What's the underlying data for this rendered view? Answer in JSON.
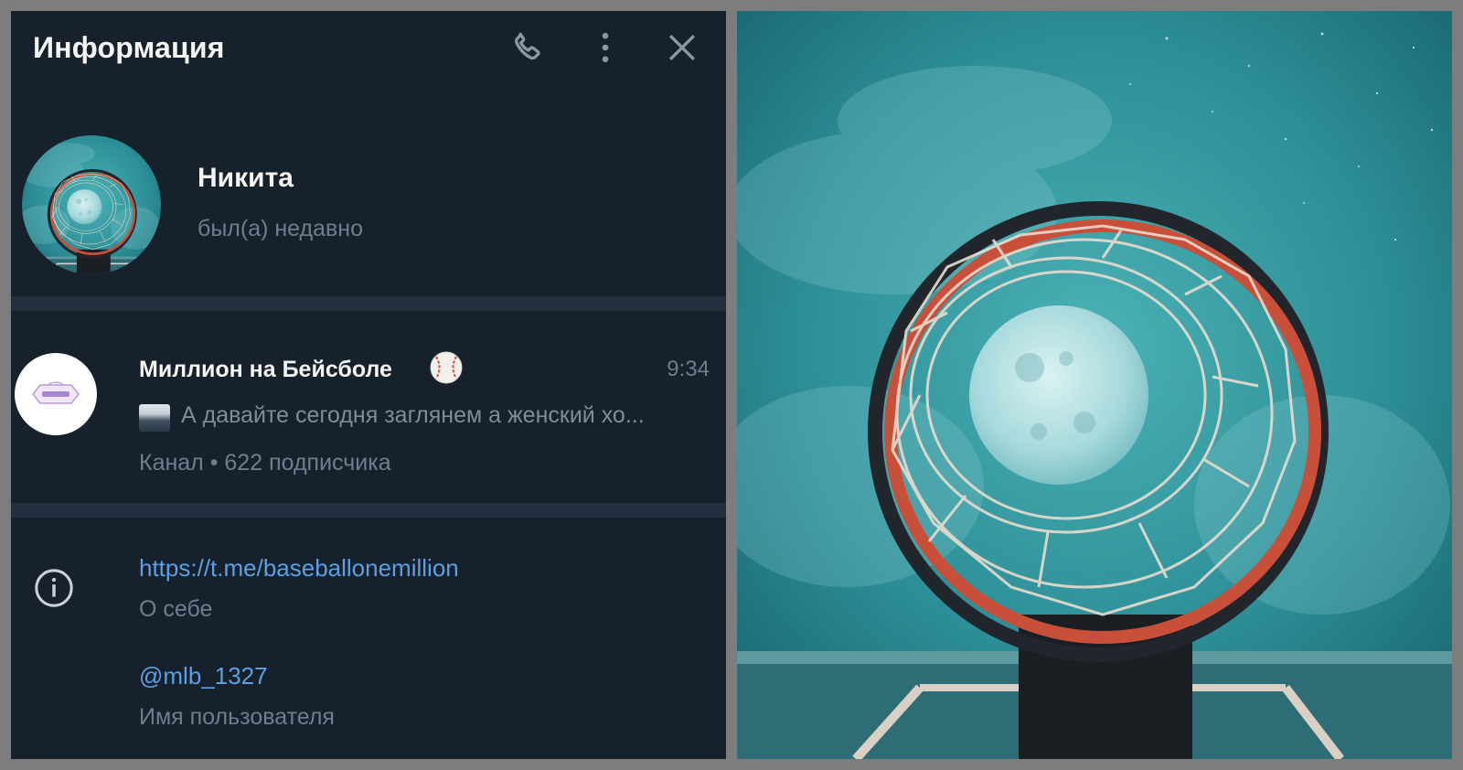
{
  "header": {
    "title": "Информация",
    "icons": [
      "phone-icon",
      "more-vertical-icon",
      "close-icon"
    ]
  },
  "profile": {
    "name": "Никита",
    "status": "был(а) недавно",
    "avatar": "basketball-hoop-photo"
  },
  "channel": {
    "name": "Миллион на Бейсболе",
    "emoji": "baseball-emoji",
    "time": "9:34",
    "last_message": "А давайте сегодня заглянем а женский хо...",
    "meta": "Канал • 622 подписчика"
  },
  "info": {
    "icon": "info-icon",
    "link": "https://t.me/baseballonemillion",
    "link_label": "О себе",
    "username": "@mlb_1327",
    "username_label": "Имя пользователя"
  },
  "colors": {
    "panel_bg": "#17212b",
    "separator": "#232e3c",
    "link": "#5aa0e3",
    "muted": "#6d7f8f",
    "text": "#f5f5f5",
    "hoop_rim": "#c8503a",
    "sky": "#2e8e96"
  },
  "photo": {
    "subject": "basketball-hoop-with-moon"
  }
}
